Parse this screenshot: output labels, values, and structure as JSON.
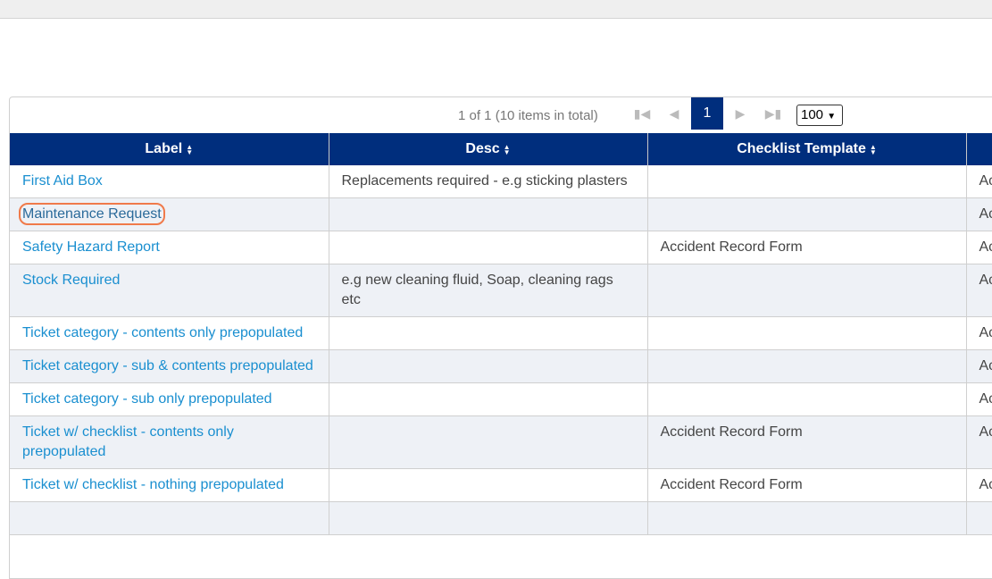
{
  "pager": {
    "info": "1 of 1 (10 items in total)",
    "current_page": "1",
    "page_size": "100"
  },
  "columns": [
    {
      "label": "Label"
    },
    {
      "label": "Desc"
    },
    {
      "label": "Checklist Template"
    },
    {
      "label": ""
    }
  ],
  "rows": [
    {
      "label": "First Aid Box",
      "desc": "Replacements required - e.g sticking plasters",
      "template": "",
      "status": "Ac"
    },
    {
      "label": "Maintenance Request",
      "desc": "",
      "template": "",
      "status": "Ac"
    },
    {
      "label": "Safety Hazard Report",
      "desc": "",
      "template": "Accident Record Form",
      "status": "Ac"
    },
    {
      "label": "Stock Required",
      "desc": "e.g new cleaning fluid, Soap, cleaning rags etc",
      "template": "",
      "status": "Ac"
    },
    {
      "label": "Ticket category - contents only prepopulated",
      "desc": "",
      "template": "",
      "status": "Ac"
    },
    {
      "label": "Ticket category - sub & contents prepopulated",
      "desc": "",
      "template": "",
      "status": "Ac"
    },
    {
      "label": "Ticket category - sub only prepopulated",
      "desc": "",
      "template": "",
      "status": "Ac"
    },
    {
      "label": "Ticket w/ checklist - contents only prepopulated",
      "desc": "",
      "template": "Accident Record Form",
      "status": "Ac"
    },
    {
      "label": "Ticket w/ checklist - nothing prepopulated",
      "desc": "",
      "template": "Accident Record Form",
      "status": "Ac"
    }
  ],
  "colors": {
    "header_bg": "#002e7d",
    "link": "#1a8fd0",
    "highlight": "#f07a4a",
    "stripe": "#eef1f6"
  }
}
